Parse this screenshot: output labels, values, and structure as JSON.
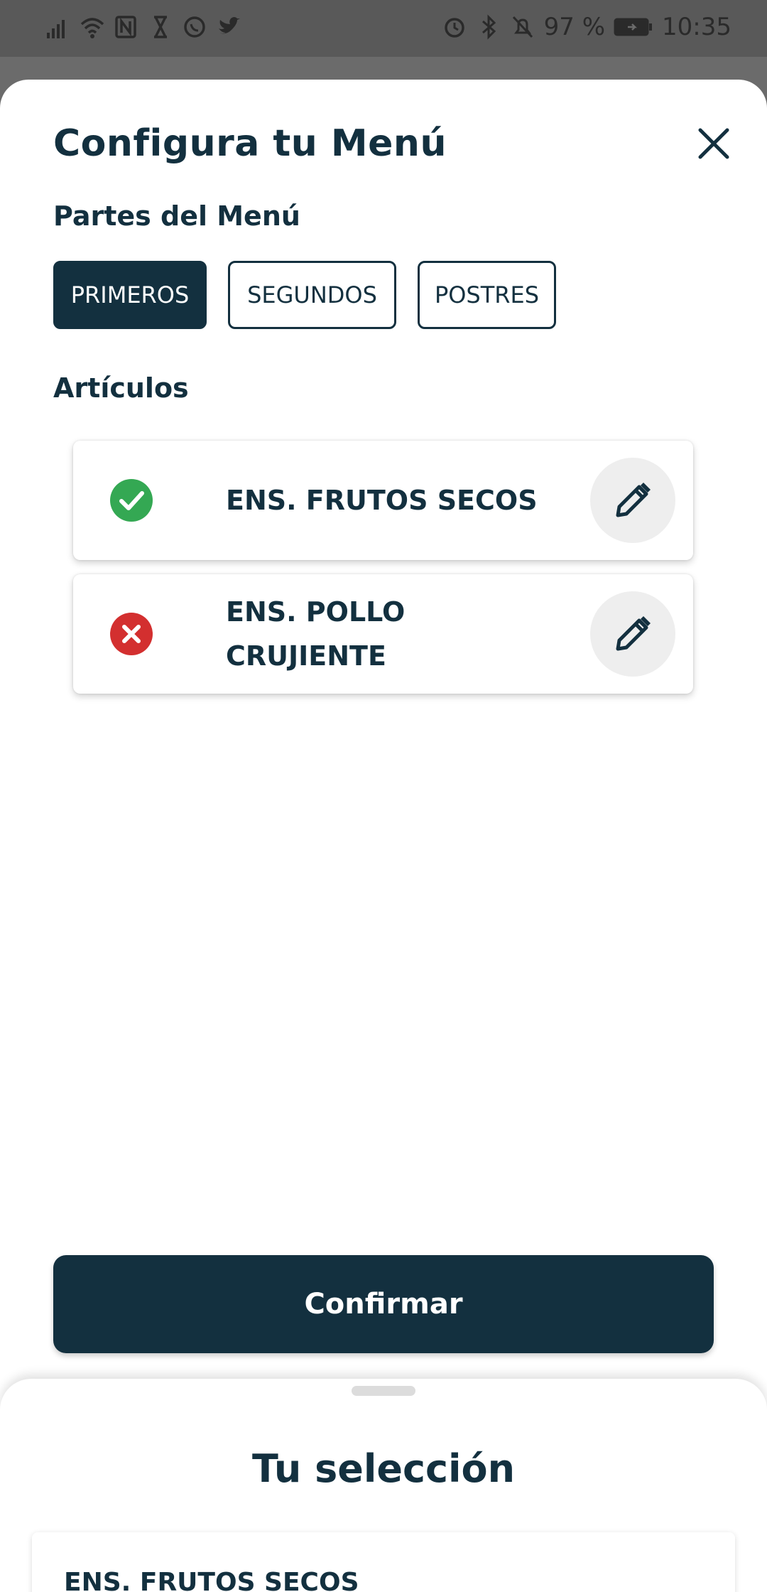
{
  "status_bar": {
    "battery": "97 %",
    "time": "10:35",
    "left_icons": [
      "signal-icon",
      "wifi-icon",
      "nfc-icon",
      "hourglass-icon",
      "whatsapp-icon",
      "twitter-icon"
    ],
    "right_icons": [
      "alarm-icon",
      "bluetooth-icon",
      "mute-icon",
      "battery-icon"
    ]
  },
  "sheet": {
    "title": "Configura tu Menú",
    "close_icon": "close-icon",
    "parts_label": "Partes del Menú",
    "tabs": [
      {
        "label": "PRIMEROS",
        "active": true
      },
      {
        "label": "SEGUNDOS",
        "active": false
      },
      {
        "label": "POSTRES",
        "active": false
      }
    ],
    "items_label": "Artículos",
    "items": [
      {
        "name": "ENS. FRUTOS SECOS",
        "status": "selected",
        "status_icon": "check-circle-icon",
        "edit_icon": "pencil-icon"
      },
      {
        "name": "ENS. POLLO CRUJIENTE",
        "status": "unselected",
        "status_icon": "cancel-circle-icon",
        "edit_icon": "pencil-icon"
      }
    ],
    "confirm_label": "Confirmar"
  },
  "selection": {
    "title": "Tu selección",
    "items": [
      "ENS. FRUTOS SECOS"
    ]
  },
  "colors": {
    "primary": "#13303f",
    "success": "#34a853",
    "danger": "#d32f2f",
    "edit_bg": "#eeeeee"
  }
}
